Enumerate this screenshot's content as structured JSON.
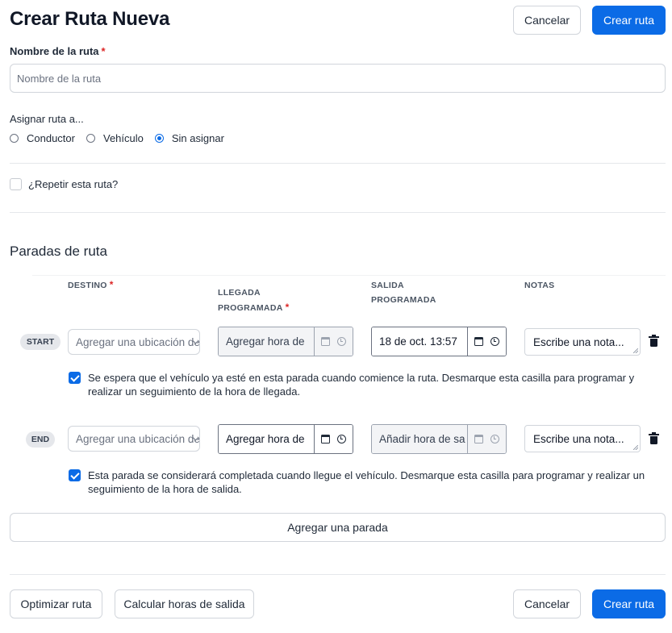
{
  "header": {
    "title": "Crear Ruta Nueva",
    "cancel_label": "Cancelar",
    "create_label": "Crear ruta"
  },
  "route_name": {
    "label": "Nombre de la ruta",
    "required_mark": "*",
    "placeholder": "Nombre de la ruta",
    "value": ""
  },
  "assign": {
    "label": "Asignar ruta a...",
    "options": [
      "Conductor",
      "Vehículo",
      "Sin asignar"
    ],
    "selected": "Sin asignar"
  },
  "repeat": {
    "label": "¿Repetir esta ruta?",
    "checked": false
  },
  "stops_section": {
    "title": "Paradas de ruta",
    "columns": {
      "destino": "DESTINO",
      "llegada_line1": "LLEGADA",
      "llegada_line2": "PROGRAMADA",
      "salida_line1": "SALIDA",
      "salida_line2": "PROGRAMADA",
      "notas": "NOTAS"
    },
    "required_mark": "*",
    "stops": [
      {
        "badge": "START",
        "location_placeholder": "Agregar una ubicación de",
        "arrival_text": "Agregar hora de",
        "departure_text": "18 de oct. 13:57",
        "notes_placeholder": "Escribe una nota...",
        "checkbox_checked": true,
        "checkbox_text": "Se espera que el vehículo ya esté en esta parada cuando comience la ruta. Desmarque esta casilla para programar y realizar un seguimiento de la hora de llegada."
      },
      {
        "badge": "END",
        "location_placeholder": "Agregar una ubicación de",
        "arrival_text": "Agregar hora de",
        "departure_text": "Añadir hora de sa",
        "notes_placeholder": "Escribe una nota...",
        "checkbox_checked": true,
        "checkbox_text": "Esta parada se considerará completada cuando llegue el vehículo. Desmarque esta casilla para programar y realizar un seguimiento de la hora de salida."
      }
    ],
    "add_stop_label": "Agregar una parada"
  },
  "footer": {
    "optimize_label": "Optimizar ruta",
    "calc_label": "Calcular horas de salida",
    "cancel_label": "Cancelar",
    "create_label": "Crear ruta"
  },
  "colors": {
    "primary": "#0b6be6",
    "required": "#dc2626",
    "border": "#d1d5db"
  }
}
